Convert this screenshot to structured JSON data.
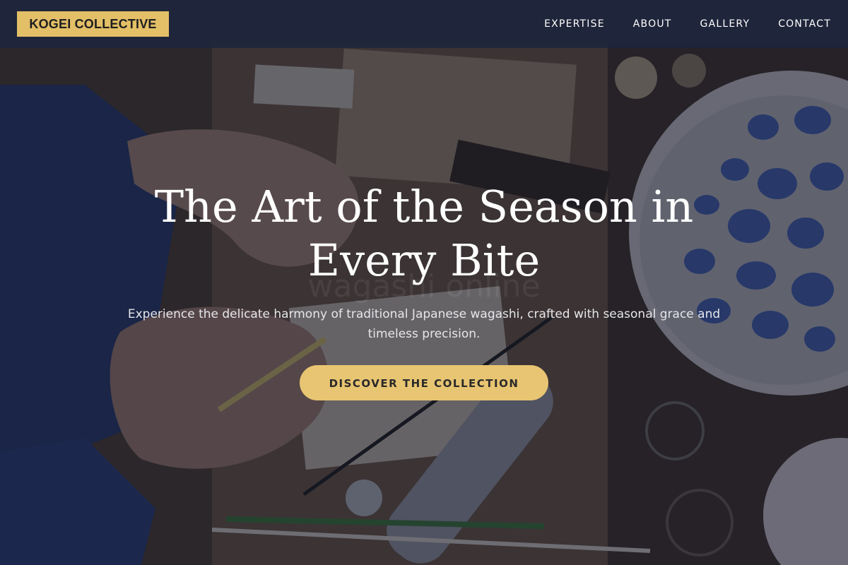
{
  "nav": {
    "logo": "KOGEI COLLECTIVE",
    "links": [
      {
        "label": "EXPERTISE"
      },
      {
        "label": "ABOUT"
      },
      {
        "label": "GALLERY"
      },
      {
        "label": "CONTACT"
      }
    ]
  },
  "hero": {
    "title": "The Art of the Season in Every Bite",
    "subtitle": "Experience the delicate harmony of traditional Japanese wagashi, crafted with seasonal grace and timeless precision.",
    "cta_label": "DISCOVER THE COLLECTION",
    "image_description_name": "artisan-workbench-photo"
  },
  "colors": {
    "accent": "#e3bf67",
    "nav_bg": "#1e263c",
    "overlay": "#141828"
  }
}
